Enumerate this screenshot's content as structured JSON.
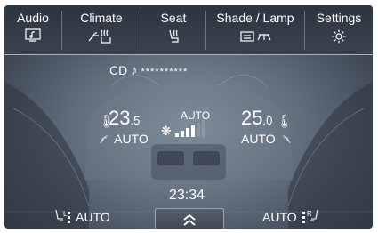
{
  "tabs": [
    {
      "label": "Audio",
      "icon": "audio-screen-icon"
    },
    {
      "label": "Climate",
      "icon": "climate-icon"
    },
    {
      "label": "Seat",
      "icon": "seat-icon"
    },
    {
      "label": "Shade / Lamp",
      "icon": "shade-lamp-icon"
    },
    {
      "label": "Settings",
      "icon": "gear-icon"
    }
  ],
  "audio": {
    "source": "CD",
    "track": "**********"
  },
  "climate": {
    "left_temp_main": "23",
    "left_temp_dec": ".5",
    "left_mode": "AUTO",
    "fan_mode": "AUTO",
    "right_temp_main": "25",
    "right_temp_dec": ".0",
    "right_mode": "AUTO"
  },
  "clock": "23:34",
  "seats": {
    "left_label": "AUTO",
    "right_label": "AUTO",
    "left_letter": "L",
    "right_letter": "R"
  }
}
